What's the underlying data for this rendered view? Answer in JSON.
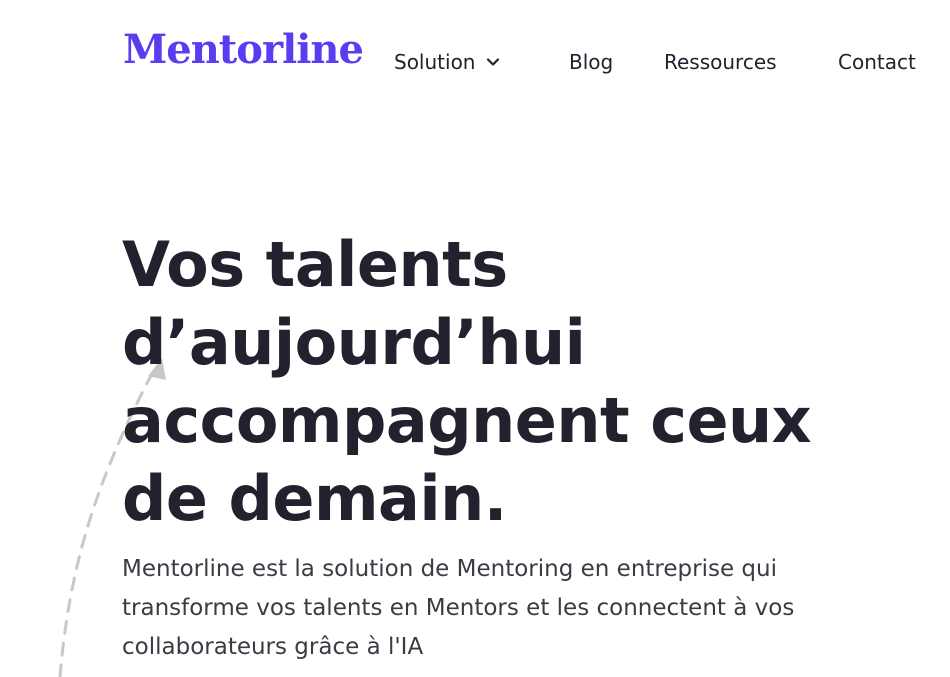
{
  "brand": {
    "logo_text": "Mentorline",
    "accent_color": "#5b3cf0",
    "text_color": "#22222f"
  },
  "nav": {
    "items": [
      {
        "label": "Solution",
        "has_dropdown": true,
        "icon": "chevron-down-icon"
      },
      {
        "label": "Blog"
      },
      {
        "label": "Ressources"
      },
      {
        "label": "Contact"
      }
    ]
  },
  "hero": {
    "title_lines": [
      "Vos talents",
      "d’aujourd’hui",
      "accompagnent ceux",
      "de demain."
    ],
    "description_lines": [
      "Mentorline est la solution de Mentoring en entreprise qui",
      "transforme vos talents en Mentors et les connectent à vos",
      "collaborateurs grâce à l'IA"
    ]
  },
  "decoration": {
    "icon": "dashed-arrow-icon",
    "color": "#c8c8c8"
  }
}
